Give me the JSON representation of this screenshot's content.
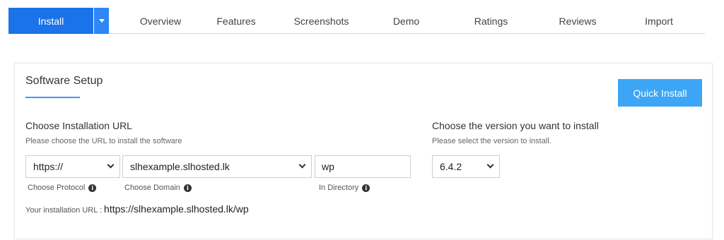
{
  "tabs": {
    "install": "Install",
    "items": [
      {
        "label": "Overview"
      },
      {
        "label": "Features"
      },
      {
        "label": "Screenshots"
      },
      {
        "label": "Demo"
      },
      {
        "label": "Ratings"
      },
      {
        "label": "Reviews"
      },
      {
        "label": "Import"
      }
    ]
  },
  "panel": {
    "title": "Software Setup",
    "quick_install": "Quick Install"
  },
  "url_section": {
    "heading": "Choose Installation URL",
    "sub": "Please choose the URL to install the software",
    "protocol_value": "https://",
    "protocol_label": "Choose Protocol",
    "domain_value": "slhexample.slhosted.lk",
    "domain_label": "Choose Domain",
    "directory_value": "wp",
    "directory_label": "In Directory",
    "install_url_label": "Your installation URL :",
    "install_url_value": "https://slhexample.slhosted.lk/wp"
  },
  "version_section": {
    "heading": "Choose the version you want to install",
    "sub": "Please select the version to install.",
    "version_value": "6.4.2"
  },
  "colors": {
    "install_tab": "#1a73e8",
    "quick_install": "#3da5f5",
    "accent_underline": "#3a9bf6"
  },
  "icons": {
    "info": "info-icon",
    "dropdown": "chevron-down-icon"
  }
}
